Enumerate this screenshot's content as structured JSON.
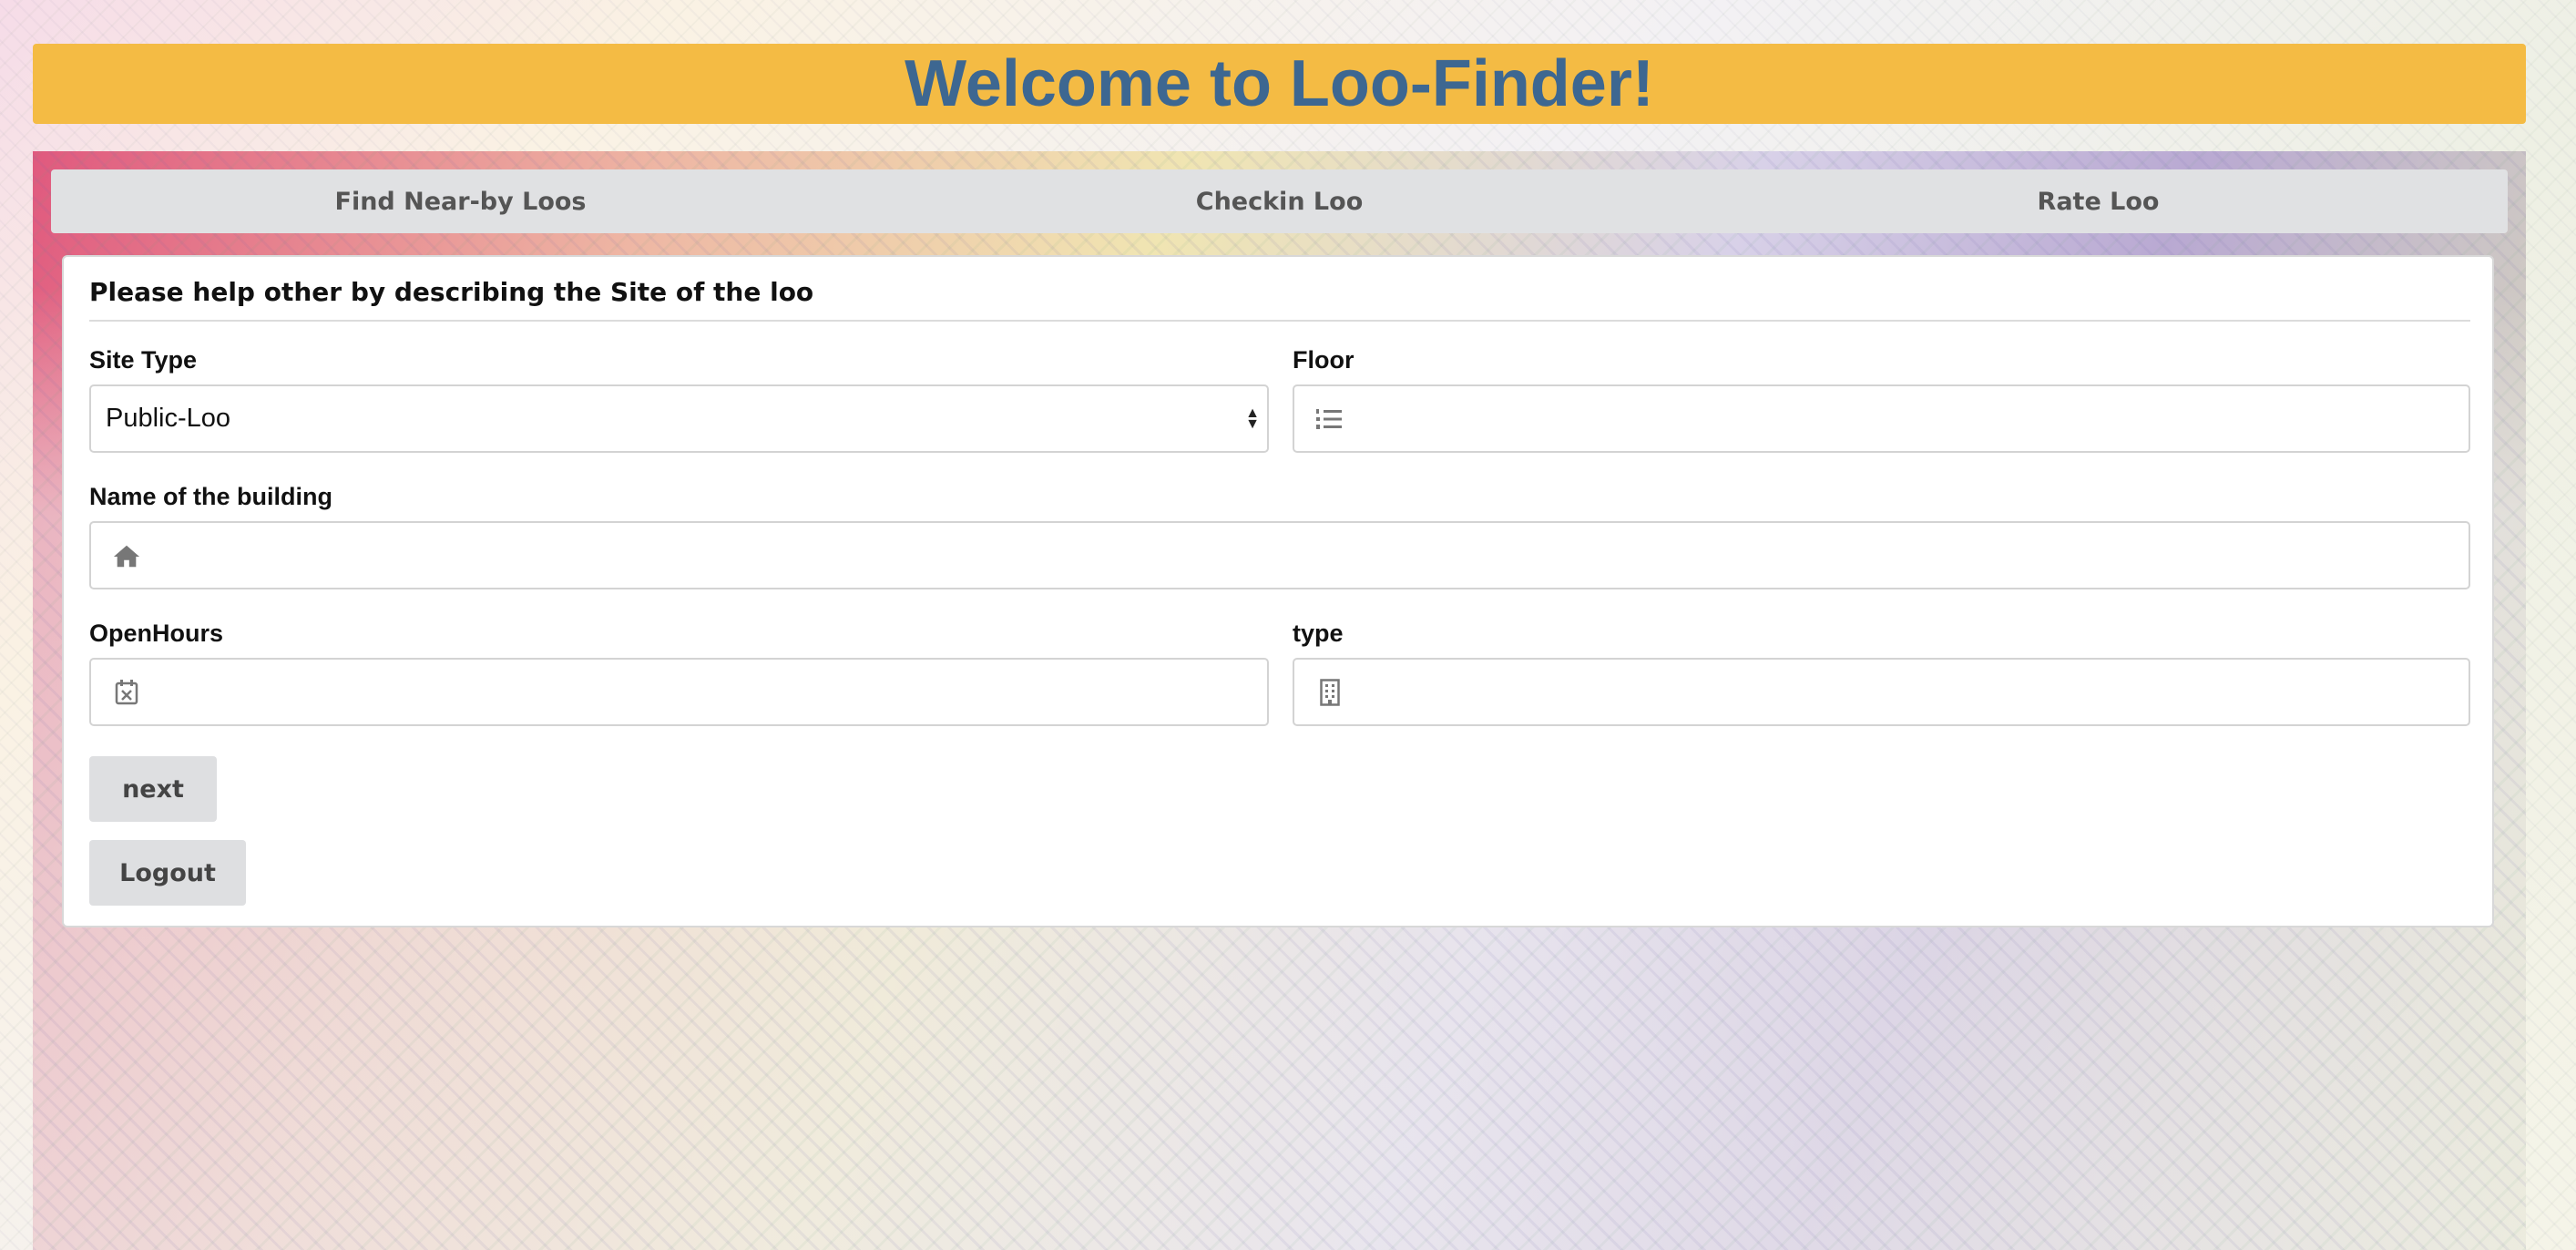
{
  "header": {
    "title": "Welcome to Loo-Finder!"
  },
  "nav": {
    "items": [
      {
        "label": "Find Near-by Loos"
      },
      {
        "label": "Checkin Loo"
      },
      {
        "label": "Rate Loo"
      }
    ]
  },
  "form": {
    "title": "Please help other by describing the Site of the loo",
    "site_type": {
      "label": "Site Type",
      "value": "Public-Loo"
    },
    "floor": {
      "label": "Floor",
      "value": "",
      "icon": "list-numbered-icon"
    },
    "building": {
      "label": "Name of the building",
      "value": "",
      "icon": "home-icon"
    },
    "open_hours": {
      "label": "OpenHours",
      "value": "",
      "icon": "calendar-x-icon"
    },
    "type": {
      "label": "type",
      "value": "",
      "icon": "building-icon"
    },
    "next_label": "next",
    "logout_label": "Logout"
  },
  "colors": {
    "header_bg": "#f4bb44",
    "header_text": "#3d6791",
    "nav_bg": "#e0e1e3",
    "button_bg": "#dedfe1"
  }
}
